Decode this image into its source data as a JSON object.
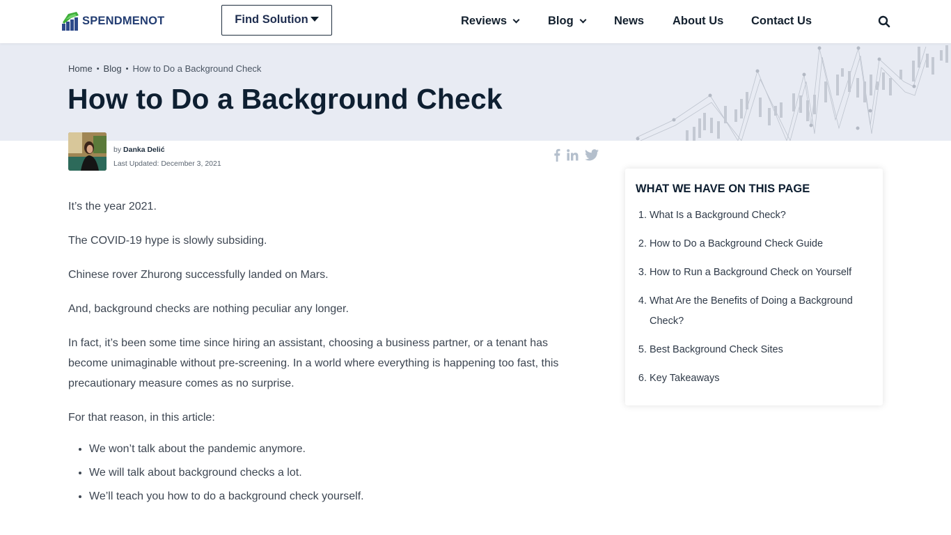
{
  "header": {
    "logo_text": "SPENDMENOT",
    "find_solution_label": "Find Solution",
    "nav": [
      {
        "label": "Reviews",
        "has_dropdown": true
      },
      {
        "label": "Blog",
        "has_dropdown": true
      },
      {
        "label": "News",
        "has_dropdown": false
      },
      {
        "label": "About Us",
        "has_dropdown": false
      },
      {
        "label": "Contact Us",
        "has_dropdown": false
      }
    ],
    "search_icon": "search-icon"
  },
  "breadcrumb": {
    "items": [
      "Home",
      "Blog",
      "How to Do a Background Check"
    ],
    "separator": "•"
  },
  "page": {
    "title": "How to Do a Background Check"
  },
  "author": {
    "by_label": "by",
    "name": "Danka Delić",
    "updated_label": "Last Updated:",
    "updated_date": "December 3, 2021"
  },
  "share": {
    "icons": [
      "facebook-icon",
      "linkedin-icon",
      "twitter-icon"
    ],
    "color": "#b4bfcc"
  },
  "article": {
    "paragraphs": [
      "It’s the year 2021.",
      "The COVID-19 hype is slowly subsiding.",
      "Chinese rover Zhurong successfully landed on Mars.",
      "And, background checks are nothing peculiar any longer.",
      "In fact, it’s been some time since hiring an assistant, choosing a business partner, or a tenant has become unimaginable without pre-screening. In a world where everything is happening too fast, this precautionary measure comes as no surprise.",
      "For that reason, in this article:"
    ],
    "bullets": [
      "We won’t talk about the pandemic anymore.",
      "We will talk about background checks a lot.",
      "We’ll teach you how to do a background check yourself."
    ]
  },
  "toc": {
    "title": "WHAT WE HAVE ON THIS PAGE",
    "items": [
      {
        "num": "1.",
        "label": "What Is a Background Check?"
      },
      {
        "num": "2.",
        "label": "How to Do a Background Check Guide"
      },
      {
        "num": "3.",
        "label": "How to Run a Background Check on Yourself"
      },
      {
        "num": "4.",
        "label": "What Are the Benefits of Doing a Background Check?"
      },
      {
        "num": "5.",
        "label": "Best Background Check Sites"
      },
      {
        "num": "6.",
        "label": "Key Takeaways"
      }
    ]
  },
  "colors": {
    "brand_navy": "#233d72",
    "brand_green": "#3fae3a",
    "hero_bg": "#e8ebf3",
    "heading": "#0e1f31"
  }
}
